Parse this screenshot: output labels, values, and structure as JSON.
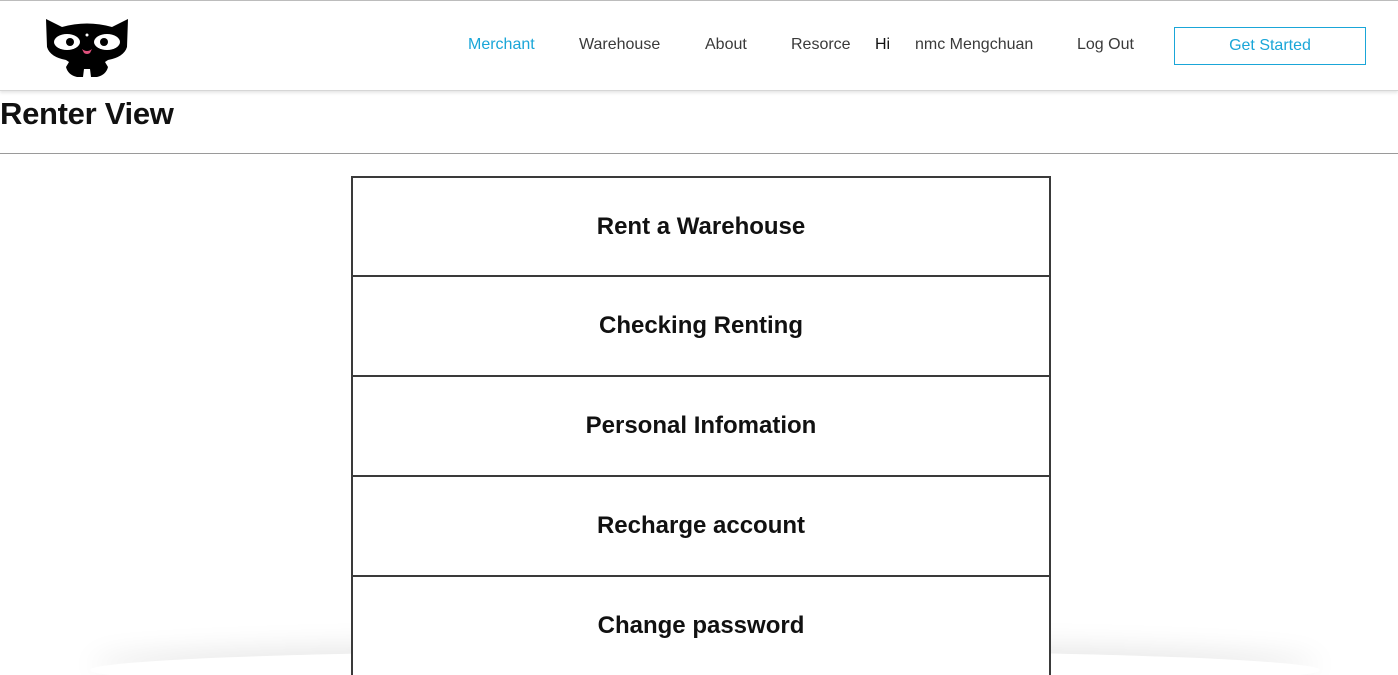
{
  "header": {
    "logo_icon": "cat-face-logo-icon",
    "nav": [
      {
        "label": "Merchant",
        "active": true
      },
      {
        "label": "Warehouse",
        "active": false
      },
      {
        "label": "About",
        "active": false
      },
      {
        "label": "Resorce",
        "active": false
      }
    ],
    "greeting": "Hi",
    "username": "nmc Mengchuan",
    "logout_label": "Log Out",
    "cta_label": "Get Started",
    "accent_color": "#1aa6d8"
  },
  "page": {
    "title": "Renter View"
  },
  "menu": {
    "items": [
      {
        "label": "Rent a Warehouse"
      },
      {
        "label": "Checking Renting"
      },
      {
        "label": "Personal Infomation"
      },
      {
        "label": "Recharge account"
      },
      {
        "label": "Change password"
      }
    ]
  }
}
